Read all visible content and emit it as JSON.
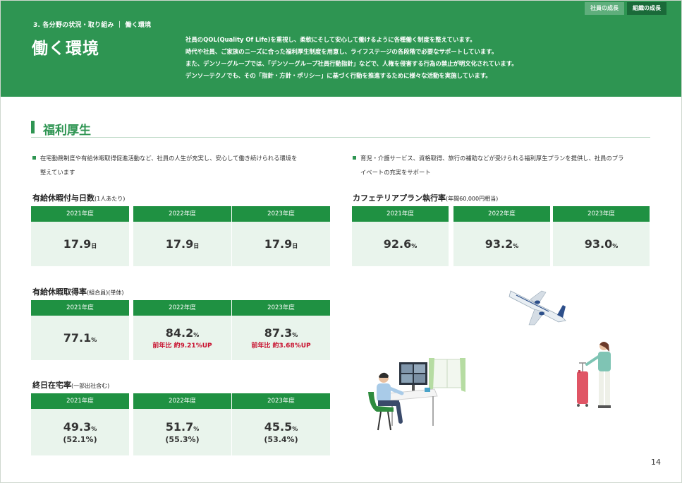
{
  "header": {
    "section_label": "3. 各分野の状況・取り組み ｜ 働く環境",
    "heading": "働く環境",
    "intro": [
      "社員のQOL(Quality Of Life)を重視し、柔軟にそして安心して働けるように各種働く制度を整えています。",
      "時代や社員、ご家族のニーズに合った福利厚生制度を用意し、ライフステージの各段階で必要なサポートしています。",
      "また、デンソーグループでは、「デンソーグループ社員行動指針」などで、人権を侵害する行為の禁止が明文化されています。",
      "デンソーテクノでも、その「指針・方針・ポリシー」に基づく行動を推進するために様々な活動を実施しています。"
    ],
    "tabs": [
      "社員の成長",
      "組織の成長"
    ]
  },
  "section": {
    "title": "福利厚生"
  },
  "bullets": {
    "left": [
      "在宅勤務制度や有給休暇取得促進活動など、社員の人生が充実し、安心して働き続けられる環境を",
      "整えています"
    ],
    "right": [
      "育児・介護サービス、資格取得、旅行の補助などが受けられる福利厚生プランを提供し、社員のプラ",
      "イベートの充実をサポート"
    ]
  },
  "metrics": {
    "paid_leave_days": {
      "title": "有給休暇付与日数",
      "note": "(1人あたり)",
      "cards": [
        {
          "year": "2021年度",
          "value": "17.9",
          "unit": "日"
        },
        {
          "year": "2022年度",
          "value": "17.9",
          "unit": "日"
        },
        {
          "year": "2023年度",
          "value": "17.9",
          "unit": "日"
        }
      ]
    },
    "cafeteria_plan": {
      "title": "カフェテリアプラン執行率",
      "note": "(年間60,000円相当)",
      "cards": [
        {
          "year": "2021年度",
          "value": "92.6",
          "unit": "%"
        },
        {
          "year": "2022年度",
          "value": "93.2",
          "unit": "%"
        },
        {
          "year": "2023年度",
          "value": "93.0",
          "unit": "%"
        }
      ]
    },
    "paid_leave_rate": {
      "title": "有給休暇取得率",
      "note": "(組合員)(単体)",
      "cards": [
        {
          "year": "2021年度",
          "value": "77.1",
          "unit": "%",
          "sub": ""
        },
        {
          "year": "2022年度",
          "value": "84.2",
          "unit": "%",
          "sub": "前年比 約9.21%UP"
        },
        {
          "year": "2023年度",
          "value": "87.3",
          "unit": "%",
          "sub": "前年比 約3.68%UP"
        }
      ]
    },
    "remote_work": {
      "title": "終日在宅率",
      "note": "(一部出社含む)",
      "cards": [
        {
          "year": "2021年度",
          "value": "49.3",
          "unit": "%",
          "paren": "(52.1%)"
        },
        {
          "year": "2022年度",
          "value": "51.7",
          "unit": "%",
          "paren": "(55.3%)"
        },
        {
          "year": "2023年度",
          "value": "45.5",
          "unit": "%",
          "paren": "(53.4%)"
        }
      ]
    }
  },
  "page_number": "14",
  "colors": {
    "brand_green": "#2e9552",
    "card_head": "#1f9142",
    "card_body": "#e9f4ec",
    "accent_red": "#c8102e"
  }
}
